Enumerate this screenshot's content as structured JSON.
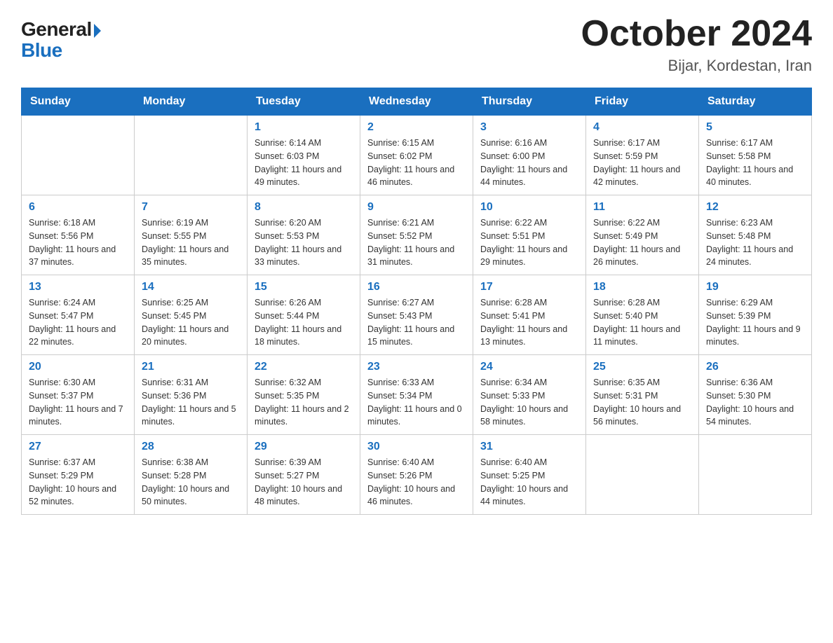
{
  "header": {
    "logo": {
      "general": "General",
      "blue": "Blue",
      "triangle": "▶"
    },
    "title": "October 2024",
    "location": "Bijar, Kordestan, Iran"
  },
  "calendar": {
    "weekdays": [
      "Sunday",
      "Monday",
      "Tuesday",
      "Wednesday",
      "Thursday",
      "Friday",
      "Saturday"
    ],
    "weeks": [
      [
        {
          "day": "",
          "sunrise": "",
          "sunset": "",
          "daylight": ""
        },
        {
          "day": "",
          "sunrise": "",
          "sunset": "",
          "daylight": ""
        },
        {
          "day": "1",
          "sunrise": "Sunrise: 6:14 AM",
          "sunset": "Sunset: 6:03 PM",
          "daylight": "Daylight: 11 hours and 49 minutes."
        },
        {
          "day": "2",
          "sunrise": "Sunrise: 6:15 AM",
          "sunset": "Sunset: 6:02 PM",
          "daylight": "Daylight: 11 hours and 46 minutes."
        },
        {
          "day": "3",
          "sunrise": "Sunrise: 6:16 AM",
          "sunset": "Sunset: 6:00 PM",
          "daylight": "Daylight: 11 hours and 44 minutes."
        },
        {
          "day": "4",
          "sunrise": "Sunrise: 6:17 AM",
          "sunset": "Sunset: 5:59 PM",
          "daylight": "Daylight: 11 hours and 42 minutes."
        },
        {
          "day": "5",
          "sunrise": "Sunrise: 6:17 AM",
          "sunset": "Sunset: 5:58 PM",
          "daylight": "Daylight: 11 hours and 40 minutes."
        }
      ],
      [
        {
          "day": "6",
          "sunrise": "Sunrise: 6:18 AM",
          "sunset": "Sunset: 5:56 PM",
          "daylight": "Daylight: 11 hours and 37 minutes."
        },
        {
          "day": "7",
          "sunrise": "Sunrise: 6:19 AM",
          "sunset": "Sunset: 5:55 PM",
          "daylight": "Daylight: 11 hours and 35 minutes."
        },
        {
          "day": "8",
          "sunrise": "Sunrise: 6:20 AM",
          "sunset": "Sunset: 5:53 PM",
          "daylight": "Daylight: 11 hours and 33 minutes."
        },
        {
          "day": "9",
          "sunrise": "Sunrise: 6:21 AM",
          "sunset": "Sunset: 5:52 PM",
          "daylight": "Daylight: 11 hours and 31 minutes."
        },
        {
          "day": "10",
          "sunrise": "Sunrise: 6:22 AM",
          "sunset": "Sunset: 5:51 PM",
          "daylight": "Daylight: 11 hours and 29 minutes."
        },
        {
          "day": "11",
          "sunrise": "Sunrise: 6:22 AM",
          "sunset": "Sunset: 5:49 PM",
          "daylight": "Daylight: 11 hours and 26 minutes."
        },
        {
          "day": "12",
          "sunrise": "Sunrise: 6:23 AM",
          "sunset": "Sunset: 5:48 PM",
          "daylight": "Daylight: 11 hours and 24 minutes."
        }
      ],
      [
        {
          "day": "13",
          "sunrise": "Sunrise: 6:24 AM",
          "sunset": "Sunset: 5:47 PM",
          "daylight": "Daylight: 11 hours and 22 minutes."
        },
        {
          "day": "14",
          "sunrise": "Sunrise: 6:25 AM",
          "sunset": "Sunset: 5:45 PM",
          "daylight": "Daylight: 11 hours and 20 minutes."
        },
        {
          "day": "15",
          "sunrise": "Sunrise: 6:26 AM",
          "sunset": "Sunset: 5:44 PM",
          "daylight": "Daylight: 11 hours and 18 minutes."
        },
        {
          "day": "16",
          "sunrise": "Sunrise: 6:27 AM",
          "sunset": "Sunset: 5:43 PM",
          "daylight": "Daylight: 11 hours and 15 minutes."
        },
        {
          "day": "17",
          "sunrise": "Sunrise: 6:28 AM",
          "sunset": "Sunset: 5:41 PM",
          "daylight": "Daylight: 11 hours and 13 minutes."
        },
        {
          "day": "18",
          "sunrise": "Sunrise: 6:28 AM",
          "sunset": "Sunset: 5:40 PM",
          "daylight": "Daylight: 11 hours and 11 minutes."
        },
        {
          "day": "19",
          "sunrise": "Sunrise: 6:29 AM",
          "sunset": "Sunset: 5:39 PM",
          "daylight": "Daylight: 11 hours and 9 minutes."
        }
      ],
      [
        {
          "day": "20",
          "sunrise": "Sunrise: 6:30 AM",
          "sunset": "Sunset: 5:37 PM",
          "daylight": "Daylight: 11 hours and 7 minutes."
        },
        {
          "day": "21",
          "sunrise": "Sunrise: 6:31 AM",
          "sunset": "Sunset: 5:36 PM",
          "daylight": "Daylight: 11 hours and 5 minutes."
        },
        {
          "day": "22",
          "sunrise": "Sunrise: 6:32 AM",
          "sunset": "Sunset: 5:35 PM",
          "daylight": "Daylight: 11 hours and 2 minutes."
        },
        {
          "day": "23",
          "sunrise": "Sunrise: 6:33 AM",
          "sunset": "Sunset: 5:34 PM",
          "daylight": "Daylight: 11 hours and 0 minutes."
        },
        {
          "day": "24",
          "sunrise": "Sunrise: 6:34 AM",
          "sunset": "Sunset: 5:33 PM",
          "daylight": "Daylight: 10 hours and 58 minutes."
        },
        {
          "day": "25",
          "sunrise": "Sunrise: 6:35 AM",
          "sunset": "Sunset: 5:31 PM",
          "daylight": "Daylight: 10 hours and 56 minutes."
        },
        {
          "day": "26",
          "sunrise": "Sunrise: 6:36 AM",
          "sunset": "Sunset: 5:30 PM",
          "daylight": "Daylight: 10 hours and 54 minutes."
        }
      ],
      [
        {
          "day": "27",
          "sunrise": "Sunrise: 6:37 AM",
          "sunset": "Sunset: 5:29 PM",
          "daylight": "Daylight: 10 hours and 52 minutes."
        },
        {
          "day": "28",
          "sunrise": "Sunrise: 6:38 AM",
          "sunset": "Sunset: 5:28 PM",
          "daylight": "Daylight: 10 hours and 50 minutes."
        },
        {
          "day": "29",
          "sunrise": "Sunrise: 6:39 AM",
          "sunset": "Sunset: 5:27 PM",
          "daylight": "Daylight: 10 hours and 48 minutes."
        },
        {
          "day": "30",
          "sunrise": "Sunrise: 6:40 AM",
          "sunset": "Sunset: 5:26 PM",
          "daylight": "Daylight: 10 hours and 46 minutes."
        },
        {
          "day": "31",
          "sunrise": "Sunrise: 6:40 AM",
          "sunset": "Sunset: 5:25 PM",
          "daylight": "Daylight: 10 hours and 44 minutes."
        },
        {
          "day": "",
          "sunrise": "",
          "sunset": "",
          "daylight": ""
        },
        {
          "day": "",
          "sunrise": "",
          "sunset": "",
          "daylight": ""
        }
      ]
    ]
  }
}
